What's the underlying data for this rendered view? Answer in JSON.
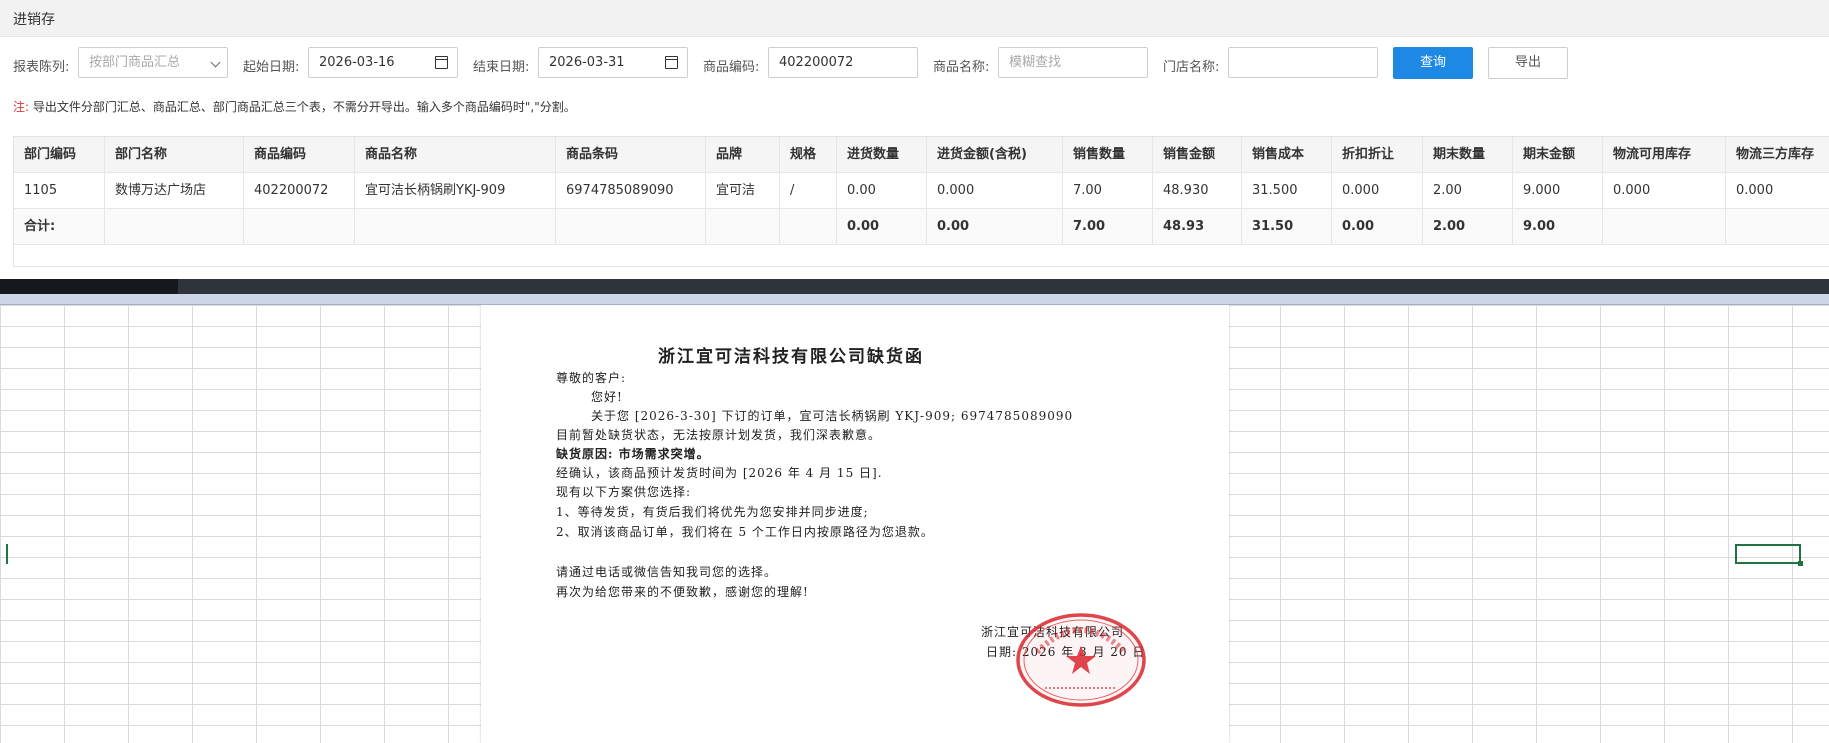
{
  "header": {
    "title": "进销存"
  },
  "filters": {
    "report_label": "报表陈列:",
    "report_value": "按部门商品汇总",
    "start_label": "起始日期:",
    "start_value": "2026-03-16",
    "end_label": "结束日期:",
    "end_value": "2026-03-31",
    "code_label": "商品编码:",
    "code_value": "402200072",
    "name_label": "商品名称:",
    "name_placeholder": "模糊查找",
    "store_label": "门店名称:",
    "store_value": "",
    "query_label": "查询",
    "export_label": "导出"
  },
  "note": {
    "prefix": "注:",
    "text": "导出文件分部门汇总、商品汇总、部门商品汇总三个表，不需分开导出。输入多个商品编码时\",\"分割。"
  },
  "table": {
    "columns": [
      "部门编码",
      "部门名称",
      "商品编码",
      "商品名称",
      "商品条码",
      "品牌",
      "规格",
      "进货数量",
      "进货金额(含税)",
      "销售数量",
      "销售金额",
      "销售成本",
      "折扣折让",
      "期末数量",
      "期末金额",
      "物流可用库存",
      "物流三方库存"
    ],
    "rows": [
      [
        "1105",
        "数博万达广场店",
        "402200072",
        "宜可洁长柄锅刷YKJ-909",
        "6974785089090",
        "宜可洁",
        "/",
        "0.00",
        "0.000",
        "7.00",
        "48.930",
        "31.500",
        "0.000",
        "2.00",
        "9.000",
        "0.000",
        "0.000"
      ]
    ],
    "total": [
      "合计:",
      "",
      "",
      "",
      "",
      "",
      "",
      "0.00",
      "0.00",
      "7.00",
      "48.93",
      "31.50",
      "0.00",
      "2.00",
      "9.00",
      "",
      ""
    ]
  },
  "letter": {
    "title": "浙江宜可洁科技有限公司缺货函",
    "salutation": "尊敬的客户:",
    "greeting": "您好!",
    "line1": "关于您 [2026-3-30] 下订的订单，宜可洁长柄锅刷 YKJ-909;   6974785089090",
    "line2": "目前暂处缺货状态，无法按原计划发货，我们深表歉意。",
    "reason": "缺货原因: 市场需求突增。",
    "confirm": "经确认，该商品预计发货时间为 [2026 年 4 月 15 日].",
    "options_intro": "现有以下方案供您选择:",
    "option1": "1、等待发货，有货后我们将优先为您安排并同步进度;",
    "option2": "2、取消该商品订单，我们将在 5 个工作日内按原路径为您退款。",
    "contact": "请通过电话或微信告知我司您的选择。",
    "apology": "再次为给您带来的不便致歉，感谢您的理解!",
    "sign_company": "浙江宜可洁科技有限公司",
    "sign_date": "日期: 2026 年 3 月 20 日"
  },
  "colors": {
    "primary": "#1e88e5",
    "note_mark": "#e53935",
    "seal": "#d9262c",
    "cell_select": "#217346"
  },
  "icons": {
    "select": "chevron-down-icon",
    "date": "calendar-icon",
    "seal": "company-seal-icon"
  }
}
